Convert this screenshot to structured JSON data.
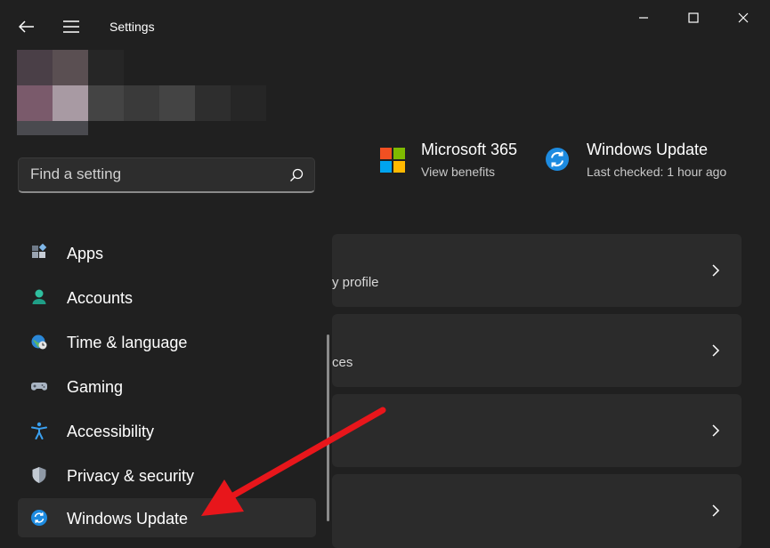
{
  "window": {
    "title": "Settings"
  },
  "search": {
    "placeholder": "Find a setting"
  },
  "sidebar": {
    "items": [
      {
        "label": "Apps",
        "icon": "apps-icon"
      },
      {
        "label": "Accounts",
        "icon": "accounts-icon"
      },
      {
        "label": "Time & language",
        "icon": "time-language-icon"
      },
      {
        "label": "Gaming",
        "icon": "gaming-icon"
      },
      {
        "label": "Accessibility",
        "icon": "accessibility-icon"
      },
      {
        "label": "Privacy & security",
        "icon": "shield-icon"
      },
      {
        "label": "Windows Update",
        "icon": "windows-update-icon",
        "selected": true
      }
    ]
  },
  "header": {
    "microsoft365": {
      "title": "Microsoft 365",
      "subtitle": "View benefits"
    },
    "windows_update": {
      "title": "Windows Update",
      "subtitle": "Last checked: 1 hour ago"
    }
  },
  "cards": [
    {
      "subtitle": "y profile"
    },
    {
      "subtitle": "ces"
    },
    {
      "subtitle": ""
    },
    {
      "subtitle": ""
    }
  ],
  "colors": {
    "background": "#202020",
    "card": "#2b2b2b",
    "accent": "#0078d4",
    "arrow": "#e8161b"
  }
}
